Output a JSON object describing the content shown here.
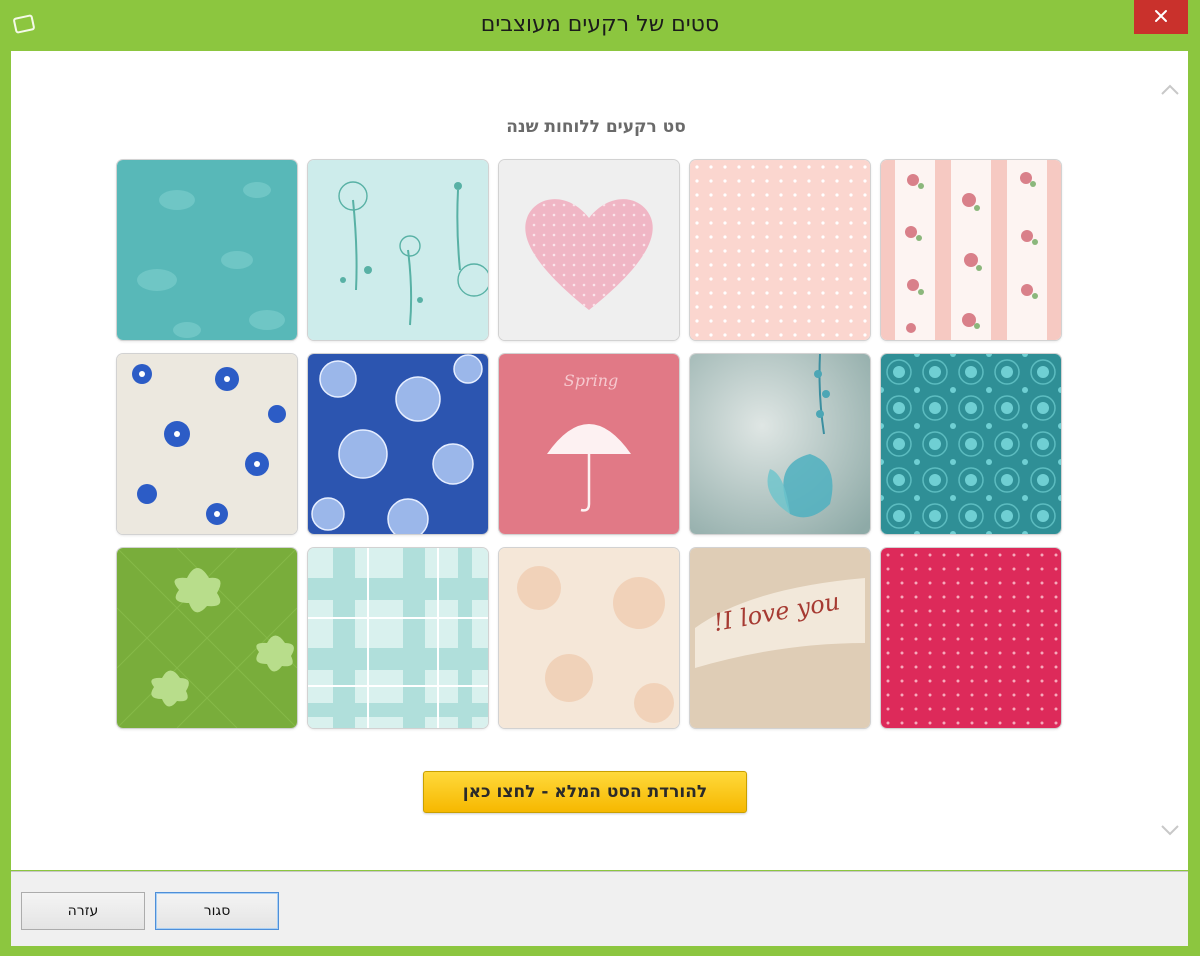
{
  "window": {
    "title": "סטים של רקעים מעוצבים",
    "icons": {
      "app": "app-window-icon",
      "close": "close-icon"
    },
    "colors": {
      "frame": "#8cc63f",
      "close_button": "#c9312c",
      "download_button": "#f6b800"
    }
  },
  "main": {
    "section_title": "סט רקעים ללוחות שנה",
    "backgrounds": [
      {
        "name": "rose-stripes"
      },
      {
        "name": "pink-dots"
      },
      {
        "name": "pink-heart"
      },
      {
        "name": "dandelion-mint"
      },
      {
        "name": "teal-birds"
      },
      {
        "name": "teal-damask"
      },
      {
        "name": "butterfly-watercolor"
      },
      {
        "name": "spring-umbrella",
        "text": "Spring"
      },
      {
        "name": "blue-roses"
      },
      {
        "name": "blue-flowers-cream"
      },
      {
        "name": "red-dots"
      },
      {
        "name": "i-love-you",
        "text": "I love you!"
      },
      {
        "name": "peach-roses"
      },
      {
        "name": "mint-plaid"
      },
      {
        "name": "green-lily"
      }
    ],
    "download_label": "להורדת הסט המלא - לחצו כאן"
  },
  "footer": {
    "close_label": "סגור",
    "help_label": "עזרה"
  }
}
